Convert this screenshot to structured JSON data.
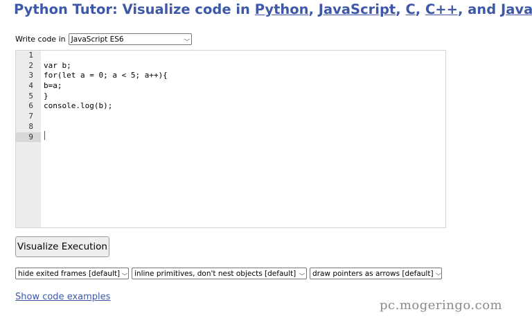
{
  "header": {
    "title_prefix": "Python Tutor: Visualize code in ",
    "links": [
      "Python",
      "JavaScript",
      "C",
      "C++"
    ],
    "sep1": ", ",
    "sep2": ", ",
    "sep3": ", ",
    "and": ", and ",
    "last_link": "Java"
  },
  "language": {
    "label": "Write code in",
    "selected": "JavaScript ES6"
  },
  "editor": {
    "line_numbers": [
      "1",
      "2",
      "3",
      "4",
      "5",
      "6",
      "7",
      "8",
      "9"
    ],
    "active_line": 9,
    "lines": [
      "",
      "var b;",
      "for(let a = 0; a < 5; a++){",
      "b=a;",
      "}",
      "console.log(b);",
      "",
      "",
      ""
    ]
  },
  "buttons": {
    "visualize": "Visualize Execution"
  },
  "options": {
    "frames": "hide exited frames [default]",
    "primitives": "inline primitives, don't nest objects [default]",
    "pointers": "draw pointers as arrows [default]"
  },
  "examples_link": "Show code examples",
  "watermark": "pc.mogeringo.com",
  "colors": {
    "link": "#3d58a8",
    "keyword": "#1a1aa6",
    "gutter": "#ececec"
  }
}
